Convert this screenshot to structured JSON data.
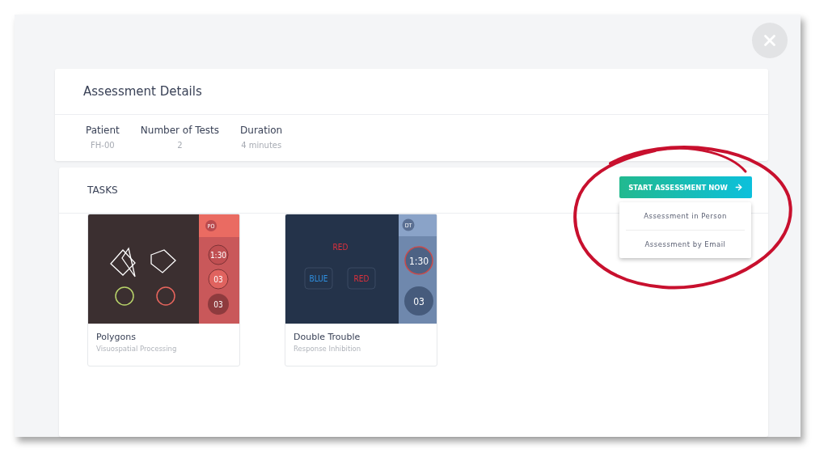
{
  "details": {
    "title": "Assessment Details",
    "fields": [
      {
        "label": "Patient",
        "value": "FH-00"
      },
      {
        "label": "Number of Tests",
        "value": "2"
      },
      {
        "label": "Duration",
        "value": "4 minutes"
      }
    ]
  },
  "tasks": {
    "title": "TASKS",
    "start_button": "START ASSESSMENT NOW",
    "menu_open": true,
    "menu_items": [
      "Assessment in Person",
      "Assessment by Email"
    ],
    "items": [
      {
        "kind": "polygons",
        "title": "Polygons",
        "subtitle": "Visuospatial Processing",
        "badge": "PO",
        "timer": "1:30",
        "level_value": "03",
        "score": "03"
      },
      {
        "kind": "double-trouble",
        "title": "Double Trouble",
        "subtitle": "Response Inhibition",
        "badge": "DT",
        "prompt": "RED",
        "choices": [
          "BLUE",
          "RED"
        ],
        "timer": "1:30",
        "score": "03"
      }
    ]
  }
}
